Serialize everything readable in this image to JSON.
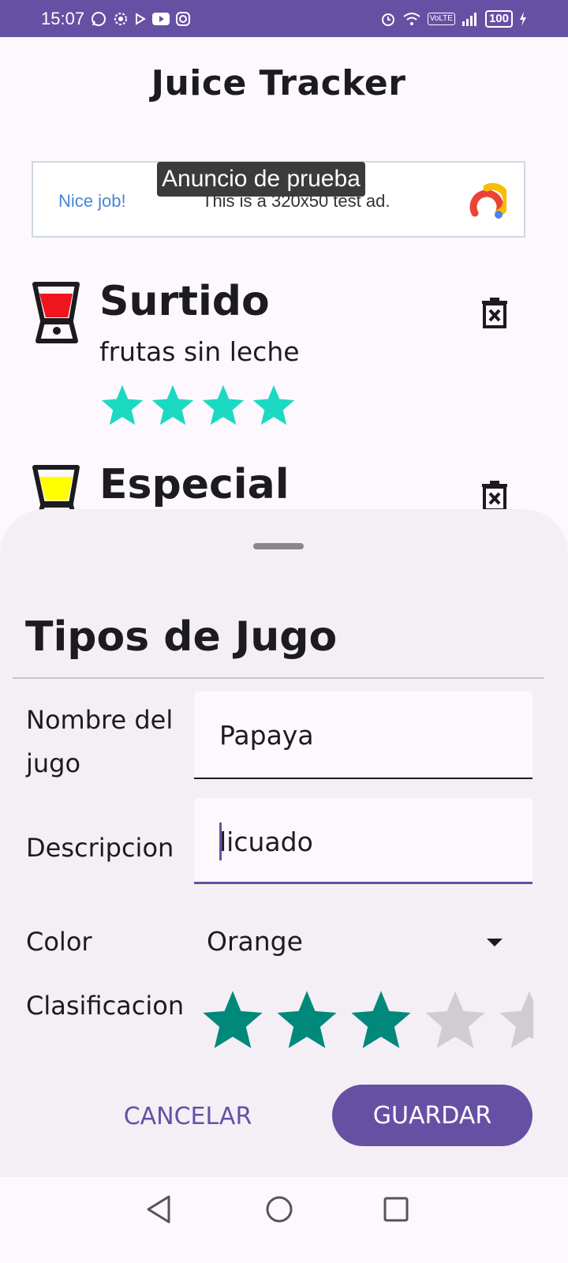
{
  "status_bar": {
    "time": "15:07",
    "volte": "VoLTE",
    "battery": "100",
    "icons": [
      "whatsapp-icon",
      "settings-icon",
      "play-icon",
      "youtube-icon",
      "instagram-icon",
      "alarm-icon",
      "wifi-icon",
      "volte-icon",
      "signal-icon",
      "battery-icon",
      "charging-icon"
    ]
  },
  "app": {
    "title": "Juice Tracker"
  },
  "ad": {
    "overlay_label": "Anuncio de prueba",
    "nice_text": "Nice job!",
    "body_text": "This is a 320x50 test ad."
  },
  "juices": [
    {
      "name": "Surtido",
      "description": "frutas sin leche",
      "rating": 4,
      "color": "#f0141e"
    },
    {
      "name": "Especial",
      "description": "",
      "rating": 0,
      "color": "#ffff00"
    }
  ],
  "sheet": {
    "title": "Tipos de Jugo",
    "name_label": "Nombre del jugo",
    "name_value": "Papaya",
    "description_label": "Descripcion",
    "description_value": "licuado",
    "color_label": "Color",
    "color_value": "Orange",
    "rating_label": "Clasificacion",
    "rating_value": 3,
    "rating_max": 5,
    "cancel_label": "CANCELAR",
    "save_label": "GUARDAR"
  },
  "colors": {
    "primary": "#6650a4",
    "list_star": "#1cd9c1",
    "rating_star": "#00897b",
    "rating_star_empty": "#d0cdd2"
  }
}
